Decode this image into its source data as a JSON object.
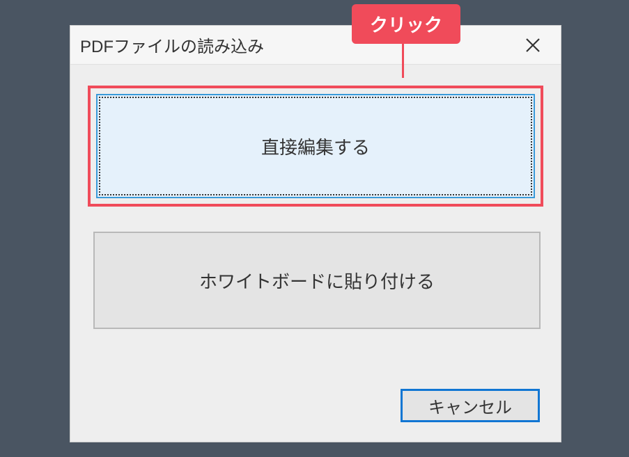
{
  "dialog": {
    "title": "PDFファイルの読み込み",
    "option_primary": "直接編集する",
    "option_secondary": "ホワイトボードに貼り付ける",
    "cancel": "キャンセル"
  },
  "callout": {
    "label": "クリック"
  },
  "colors": {
    "highlight": "#f04b5a",
    "primary_border": "#1176d3",
    "option_bg": "#e5f1fb"
  }
}
